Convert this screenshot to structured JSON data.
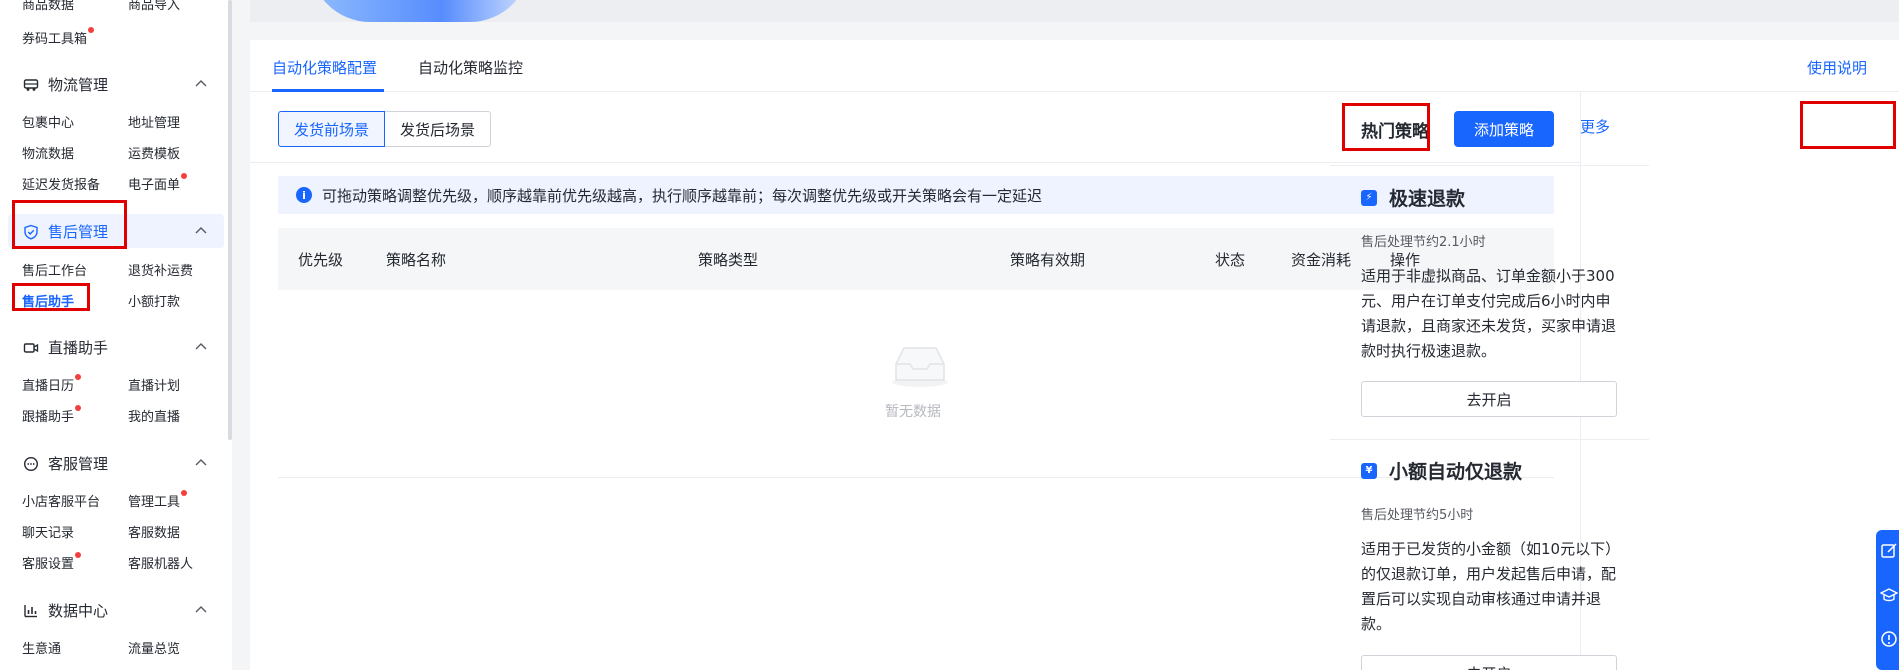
{
  "sidebar": {
    "top_items": [
      "商品数据",
      "商品导入",
      "券码工具箱"
    ],
    "logistics": {
      "title": "物流管理",
      "items": [
        "包裹中心",
        "地址管理",
        "物流数据",
        "运费模板",
        "延迟发货报备",
        "电子面单"
      ]
    },
    "aftersale": {
      "title": "售后管理",
      "items": [
        "售后工作台",
        "退货补运费",
        "售后助手",
        "小额打款"
      ]
    },
    "live": {
      "title": "直播助手",
      "items": [
        "直播日历",
        "直播计划",
        "跟播助手",
        "我的直播"
      ]
    },
    "service": {
      "title": "客服管理",
      "items": [
        "小店客服平台",
        "管理工具",
        "聊天记录",
        "客服数据",
        "客服设置",
        "客服机器人"
      ]
    },
    "data": {
      "title": "数据中心",
      "items": [
        "生意通",
        "流量总览"
      ]
    }
  },
  "tabs": [
    "自动化策略配置",
    "自动化策略监控"
  ],
  "help_link": "使用说明",
  "scene_tabs": [
    "发货前场景",
    "发货后场景"
  ],
  "add_button": "添加策略",
  "notice": "可拖动策略调整优先级，顺序越靠前优先级越高，执行顺序越靠前；每次调整优先级或开关策略会有一定延迟",
  "table": {
    "columns": [
      "优先级",
      "策略名称",
      "策略类型",
      "策略有效期",
      "状态",
      "资金消耗",
      "操作"
    ],
    "empty_text": "暂无数据"
  },
  "hot": {
    "title": "热门策略",
    "more": "更多",
    "cards": [
      {
        "title": "极速退款",
        "subtitle": "售后处理节约2.1小时",
        "desc": "适用于非虚拟商品、订单金额小于300元、用户在订单支付完成后6小时内申请退款，且商家还未发货，买家申请退款时执行极速退款。",
        "button": "去开启"
      },
      {
        "title": "小额自动仅退款",
        "subtitle": "售后处理节约5小时",
        "desc": "适用于已发货的小金额（如10元以下）的仅退款订单，用户发起售后申请，配置后可以实现自动审核通过申请并退款。",
        "button": "去开启"
      }
    ]
  },
  "colors": {
    "accent": "#1966ff",
    "highlight": "#e00000",
    "badge": "#f53f3f"
  }
}
